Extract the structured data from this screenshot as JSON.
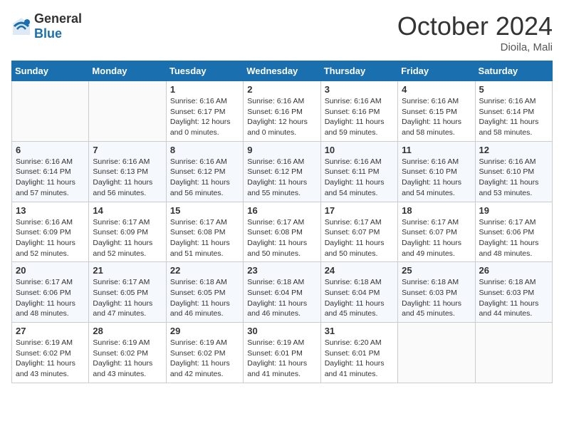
{
  "header": {
    "logo_general": "General",
    "logo_blue": "Blue",
    "month": "October 2024",
    "location": "Dioila, Mali"
  },
  "days_of_week": [
    "Sunday",
    "Monday",
    "Tuesday",
    "Wednesday",
    "Thursday",
    "Friday",
    "Saturday"
  ],
  "weeks": [
    [
      {
        "day": "",
        "info": ""
      },
      {
        "day": "",
        "info": ""
      },
      {
        "day": "1",
        "info": "Sunrise: 6:16 AM\nSunset: 6:17 PM\nDaylight: 12 hours\nand 0 minutes."
      },
      {
        "day": "2",
        "info": "Sunrise: 6:16 AM\nSunset: 6:16 PM\nDaylight: 12 hours\nand 0 minutes."
      },
      {
        "day": "3",
        "info": "Sunrise: 6:16 AM\nSunset: 6:16 PM\nDaylight: 11 hours\nand 59 minutes."
      },
      {
        "day": "4",
        "info": "Sunrise: 6:16 AM\nSunset: 6:15 PM\nDaylight: 11 hours\nand 58 minutes."
      },
      {
        "day": "5",
        "info": "Sunrise: 6:16 AM\nSunset: 6:14 PM\nDaylight: 11 hours\nand 58 minutes."
      }
    ],
    [
      {
        "day": "6",
        "info": "Sunrise: 6:16 AM\nSunset: 6:14 PM\nDaylight: 11 hours\nand 57 minutes."
      },
      {
        "day": "7",
        "info": "Sunrise: 6:16 AM\nSunset: 6:13 PM\nDaylight: 11 hours\nand 56 minutes."
      },
      {
        "day": "8",
        "info": "Sunrise: 6:16 AM\nSunset: 6:12 PM\nDaylight: 11 hours\nand 56 minutes."
      },
      {
        "day": "9",
        "info": "Sunrise: 6:16 AM\nSunset: 6:12 PM\nDaylight: 11 hours\nand 55 minutes."
      },
      {
        "day": "10",
        "info": "Sunrise: 6:16 AM\nSunset: 6:11 PM\nDaylight: 11 hours\nand 54 minutes."
      },
      {
        "day": "11",
        "info": "Sunrise: 6:16 AM\nSunset: 6:10 PM\nDaylight: 11 hours\nand 54 minutes."
      },
      {
        "day": "12",
        "info": "Sunrise: 6:16 AM\nSunset: 6:10 PM\nDaylight: 11 hours\nand 53 minutes."
      }
    ],
    [
      {
        "day": "13",
        "info": "Sunrise: 6:16 AM\nSunset: 6:09 PM\nDaylight: 11 hours\nand 52 minutes."
      },
      {
        "day": "14",
        "info": "Sunrise: 6:17 AM\nSunset: 6:09 PM\nDaylight: 11 hours\nand 52 minutes."
      },
      {
        "day": "15",
        "info": "Sunrise: 6:17 AM\nSunset: 6:08 PM\nDaylight: 11 hours\nand 51 minutes."
      },
      {
        "day": "16",
        "info": "Sunrise: 6:17 AM\nSunset: 6:08 PM\nDaylight: 11 hours\nand 50 minutes."
      },
      {
        "day": "17",
        "info": "Sunrise: 6:17 AM\nSunset: 6:07 PM\nDaylight: 11 hours\nand 50 minutes."
      },
      {
        "day": "18",
        "info": "Sunrise: 6:17 AM\nSunset: 6:07 PM\nDaylight: 11 hours\nand 49 minutes."
      },
      {
        "day": "19",
        "info": "Sunrise: 6:17 AM\nSunset: 6:06 PM\nDaylight: 11 hours\nand 48 minutes."
      }
    ],
    [
      {
        "day": "20",
        "info": "Sunrise: 6:17 AM\nSunset: 6:06 PM\nDaylight: 11 hours\nand 48 minutes."
      },
      {
        "day": "21",
        "info": "Sunrise: 6:17 AM\nSunset: 6:05 PM\nDaylight: 11 hours\nand 47 minutes."
      },
      {
        "day": "22",
        "info": "Sunrise: 6:18 AM\nSunset: 6:05 PM\nDaylight: 11 hours\nand 46 minutes."
      },
      {
        "day": "23",
        "info": "Sunrise: 6:18 AM\nSunset: 6:04 PM\nDaylight: 11 hours\nand 46 minutes."
      },
      {
        "day": "24",
        "info": "Sunrise: 6:18 AM\nSunset: 6:04 PM\nDaylight: 11 hours\nand 45 minutes."
      },
      {
        "day": "25",
        "info": "Sunrise: 6:18 AM\nSunset: 6:03 PM\nDaylight: 11 hours\nand 45 minutes."
      },
      {
        "day": "26",
        "info": "Sunrise: 6:18 AM\nSunset: 6:03 PM\nDaylight: 11 hours\nand 44 minutes."
      }
    ],
    [
      {
        "day": "27",
        "info": "Sunrise: 6:19 AM\nSunset: 6:02 PM\nDaylight: 11 hours\nand 43 minutes."
      },
      {
        "day": "28",
        "info": "Sunrise: 6:19 AM\nSunset: 6:02 PM\nDaylight: 11 hours\nand 43 minutes."
      },
      {
        "day": "29",
        "info": "Sunrise: 6:19 AM\nSunset: 6:02 PM\nDaylight: 11 hours\nand 42 minutes."
      },
      {
        "day": "30",
        "info": "Sunrise: 6:19 AM\nSunset: 6:01 PM\nDaylight: 11 hours\nand 41 minutes."
      },
      {
        "day": "31",
        "info": "Sunrise: 6:20 AM\nSunset: 6:01 PM\nDaylight: 11 hours\nand 41 minutes."
      },
      {
        "day": "",
        "info": ""
      },
      {
        "day": "",
        "info": ""
      }
    ]
  ]
}
